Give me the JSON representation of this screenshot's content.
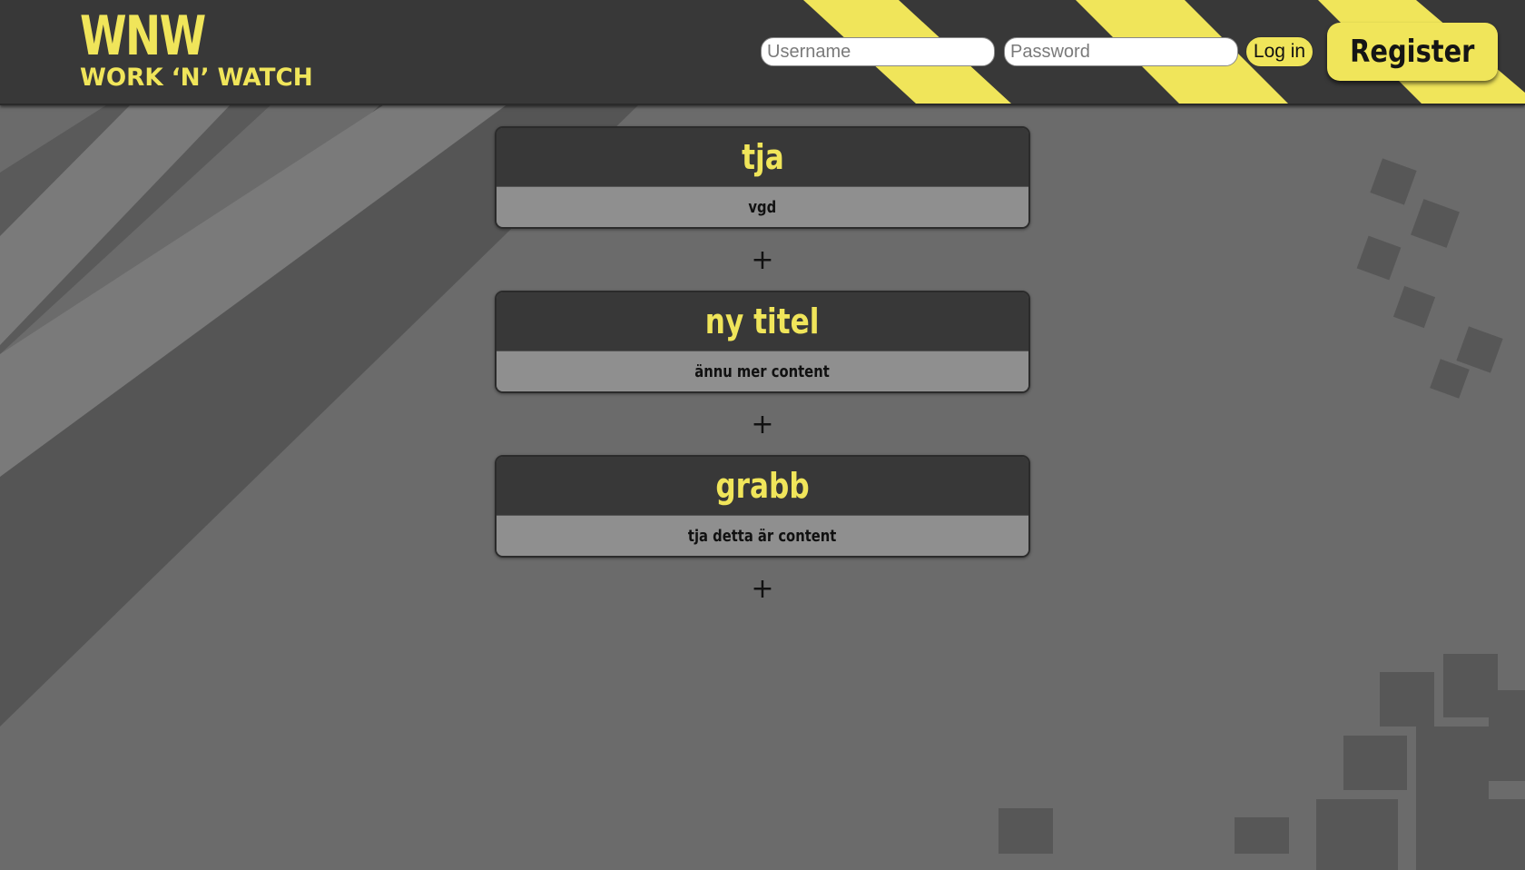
{
  "header": {
    "logo_mark": "WNW",
    "logo_text": "WORK ‘N’ WATCH",
    "username_placeholder": "Username",
    "password_placeholder": "Password",
    "username_value": "",
    "password_value": "",
    "login_label": "Log in",
    "register_label": "Register"
  },
  "cards": [
    {
      "title": "tja",
      "content": "vgd"
    },
    {
      "title": "ny titel",
      "content": "ännu mer content"
    },
    {
      "title": "grabb",
      "content": "tja detta är content"
    }
  ],
  "add_label": "+",
  "colors": {
    "accent": "#f0e55a",
    "header_bg": "#383838",
    "page_bg": "#6b6b6b",
    "card_body_bg": "#8f8f8f"
  }
}
